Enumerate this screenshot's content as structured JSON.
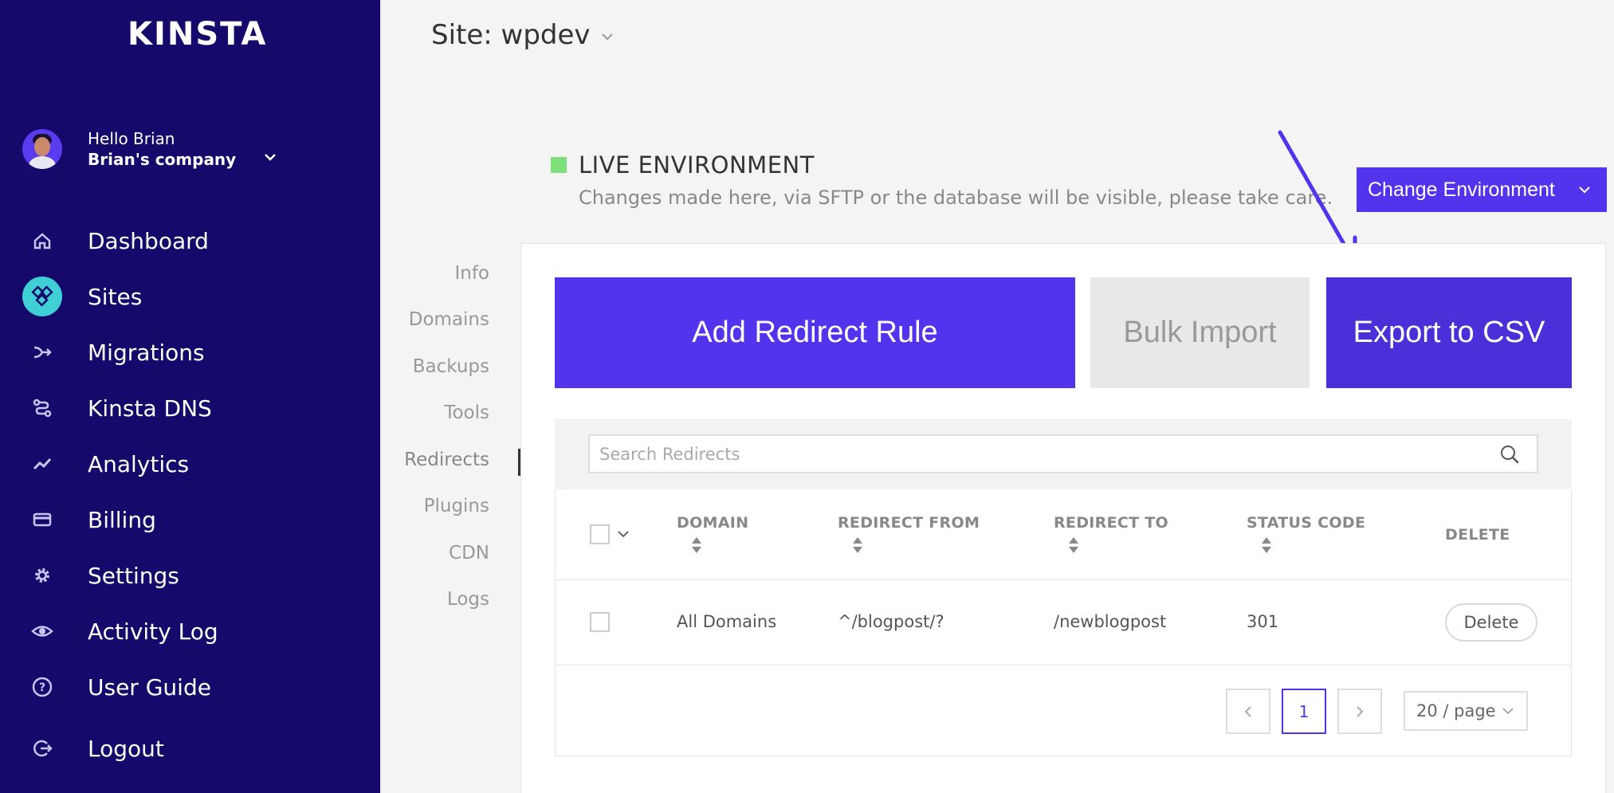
{
  "brand": {
    "logo_text": "KINSTA"
  },
  "user": {
    "greeting": "Hello Brian",
    "company": "Brian's company"
  },
  "nav": {
    "items": [
      {
        "label": "Dashboard",
        "icon": "home-icon"
      },
      {
        "label": "Sites",
        "icon": "sites-icon",
        "active": true
      },
      {
        "label": "Migrations",
        "icon": "migrations-icon"
      },
      {
        "label": "Kinsta DNS",
        "icon": "dns-icon"
      },
      {
        "label": "Analytics",
        "icon": "analytics-icon"
      },
      {
        "label": "Billing",
        "icon": "billing-icon"
      },
      {
        "label": "Settings",
        "icon": "gear-icon"
      },
      {
        "label": "Activity Log",
        "icon": "eye-icon"
      },
      {
        "label": "User Guide",
        "icon": "help-icon"
      },
      {
        "label": "Logout",
        "icon": "logout-icon"
      }
    ]
  },
  "site": {
    "label": "Site:",
    "name": "wpdev"
  },
  "environment": {
    "title": "LIVE ENVIRONMENT",
    "description": "Changes made here, via SFTP or the database will be visible, please take care.",
    "change_label": "Change Environment",
    "status_color": "#7ee07a"
  },
  "subnav": {
    "items": [
      "Info",
      "Domains",
      "Backups",
      "Tools",
      "Redirects",
      "Plugins",
      "CDN",
      "Logs"
    ],
    "active": "Redirects"
  },
  "actions": {
    "add_label": "Add Redirect Rule",
    "bulk_label": "Bulk Import",
    "export_label": "Export to CSV"
  },
  "search": {
    "placeholder": "Search Redirects",
    "value": ""
  },
  "table": {
    "headers": {
      "domain": "DOMAIN",
      "redirect_from": "REDIRECT FROM",
      "redirect_to": "REDIRECT TO",
      "status_code": "STATUS CODE",
      "delete": "DELETE"
    },
    "rows": [
      {
        "domain": "All Domains",
        "redirect_from": "^/blogpost/?",
        "redirect_to": "/newblogpost",
        "status_code": "301",
        "delete_label": "Delete"
      }
    ]
  },
  "pagination": {
    "current_page": "1",
    "per_page": "20 / page"
  },
  "colors": {
    "sidebar": "#150a6b",
    "accent": "#5333ed",
    "active_icon_bg": "#3fd0d6"
  }
}
